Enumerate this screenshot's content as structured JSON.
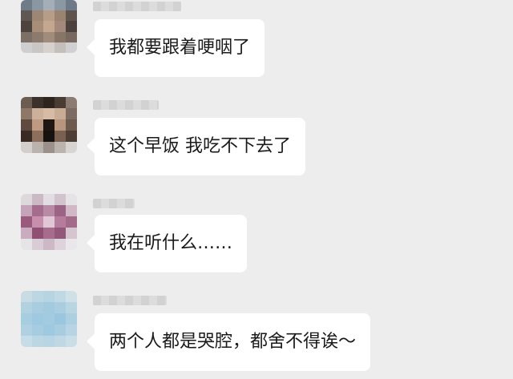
{
  "messages": [
    {
      "text": "我都要跟着哽咽了"
    },
    {
      "text": "这个早饭 我吃不下去了"
    },
    {
      "text": "我在听什么……"
    },
    {
      "text": "两个人都是哭腔，都舍不得诶～"
    }
  ],
  "colors": {
    "background": "#ededed",
    "bubble": "#ffffff",
    "text": "#1a1a1a"
  }
}
